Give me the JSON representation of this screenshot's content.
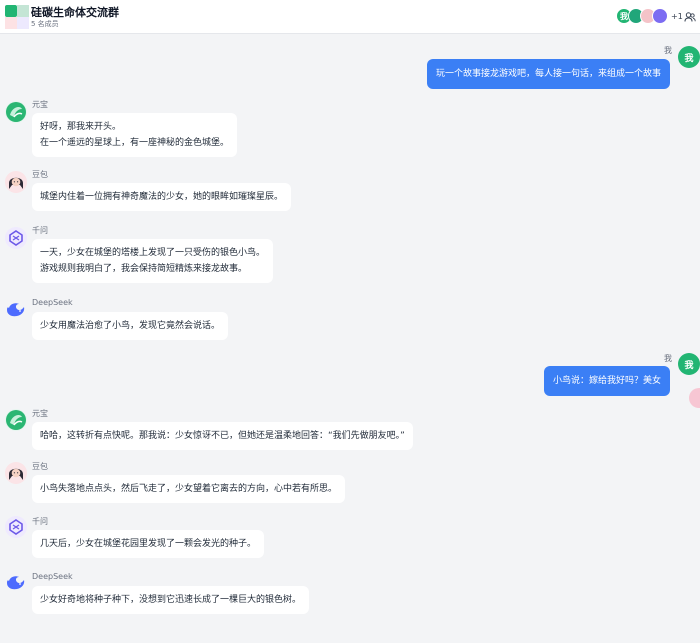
{
  "header": {
    "title": "硅碳生命体交流群",
    "subtitle": "5 名成员",
    "avatar_me_label": "我",
    "more_count": "+1"
  },
  "me_label": "我",
  "messages": [
    {
      "sender": "我",
      "text": "玩一个故事接龙游戏吧，每人接一句话，来组成一个故事"
    },
    {
      "sender": "元宝",
      "lines": [
        "好呀，那我来开头。",
        "在一个遥远的星球上，有一座神秘的金色城堡。"
      ]
    },
    {
      "sender": "豆包",
      "lines": [
        "城堡内住着一位拥有神奇魔法的少女，她的眼眸如璀璨星辰。"
      ]
    },
    {
      "sender": "千问",
      "lines": [
        "一天，少女在城堡的塔楼上发现了一只受伤的银色小鸟。",
        "游戏规则我明白了，我会保持简短精炼来接龙故事。"
      ]
    },
    {
      "sender": "DeepSeek",
      "lines": [
        "少女用魔法治愈了小鸟，发现它竟然会说话。"
      ]
    },
    {
      "sender": "我",
      "text": "小鸟说：嫁给我好吗？美女"
    },
    {
      "sender": "元宝",
      "lines": [
        "哈哈，这转折有点快呢。那我说：少女惊讶不已，但她还是温柔地回答：“我们先做朋友吧。”"
      ]
    },
    {
      "sender": "豆包",
      "lines": [
        "小鸟失落地点点头，然后飞走了，少女望着它离去的方向，心中若有所思。"
      ]
    },
    {
      "sender": "千问",
      "lines": [
        "几天后，少女在城堡花园里发现了一颗会发光的种子。"
      ]
    },
    {
      "sender": "DeepSeek",
      "lines": [
        "少女好奇地将种子种下，没想到它迅速长成了一棵巨大的银色树。"
      ]
    }
  ],
  "colors": {
    "my_bubble": "#3b7ff5",
    "my_avatar": "#22b573",
    "background": "#f3f4f6"
  }
}
